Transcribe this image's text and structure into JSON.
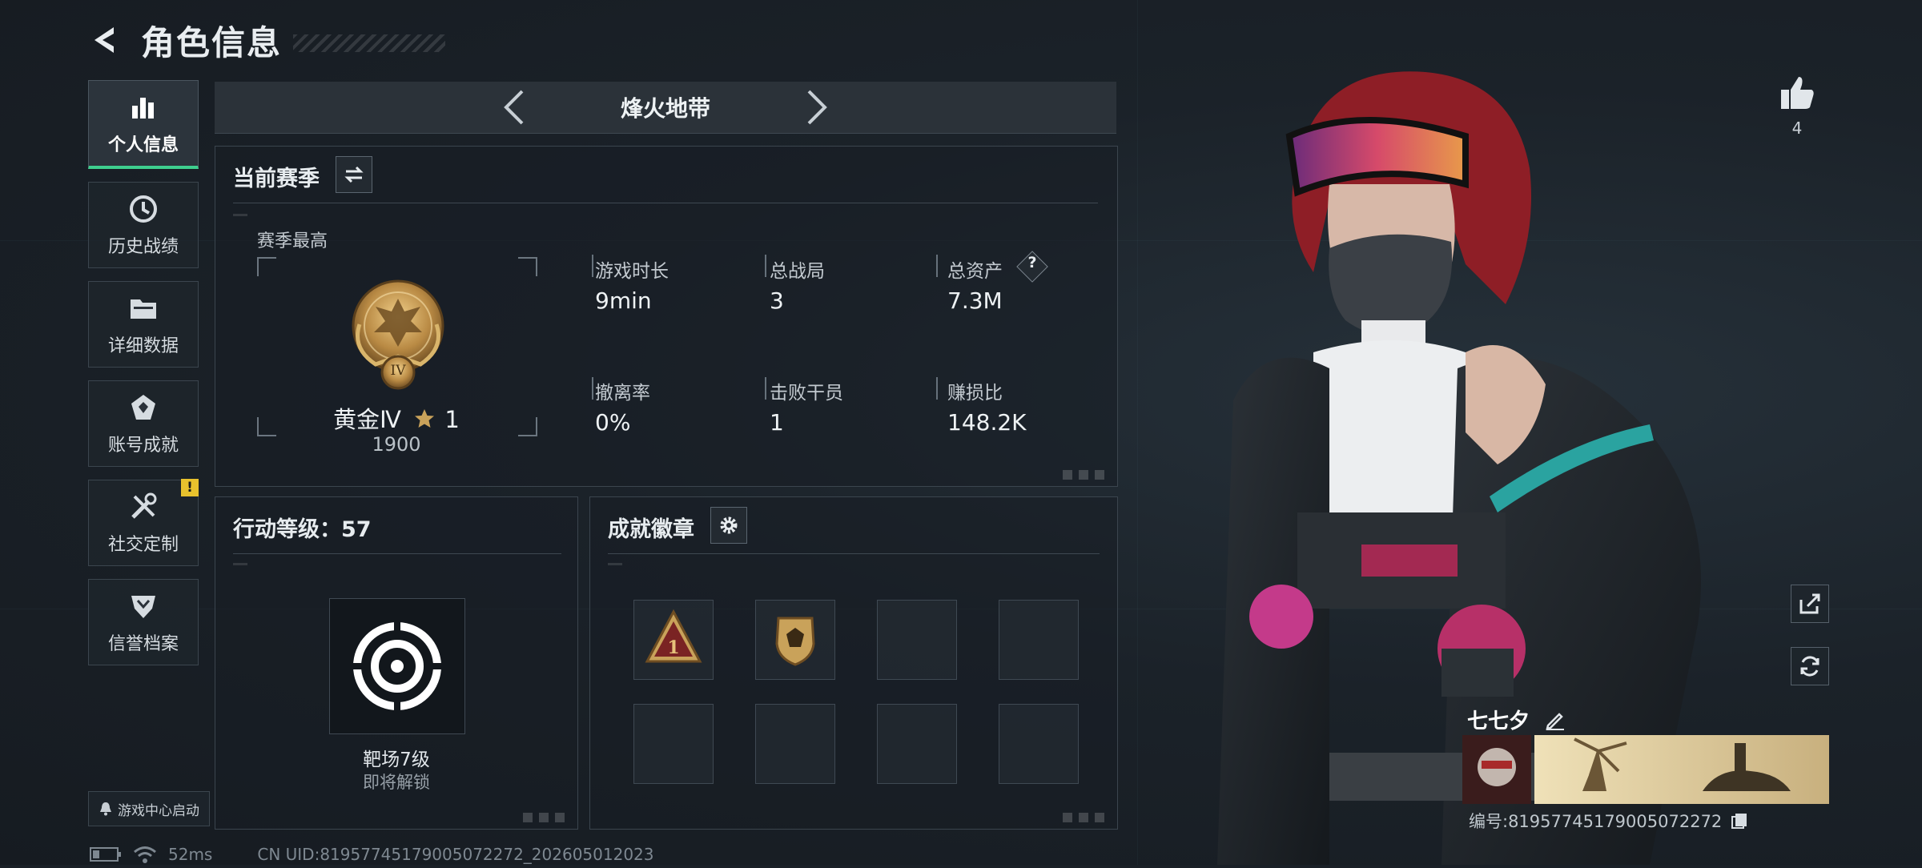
{
  "header": {
    "title": "角色信息"
  },
  "sidebar": {
    "items": [
      {
        "label": "个人信息",
        "icon": "bar-chart-icon",
        "active": true
      },
      {
        "label": "历史战绩",
        "icon": "history-clock-icon"
      },
      {
        "label": "详细数据",
        "icon": "folder-icon"
      },
      {
        "label": "账号成就",
        "icon": "achievement-icon"
      },
      {
        "label": "社交定制",
        "icon": "tools-icon",
        "alert": "!"
      },
      {
        "label": "信誉档案",
        "icon": "credit-shield-icon"
      }
    ],
    "launch_label": "游戏中心启动"
  },
  "status": {
    "ping": "52ms",
    "uid": "CN UID:81957745179005072272_202605012023"
  },
  "mode": {
    "title": "烽火地带"
  },
  "season": {
    "title": "当前赛季",
    "best_label": "赛季最高",
    "rank_name": "黄金Ⅳ",
    "rank_stars": "1",
    "rank_score": "1900",
    "rank_emblem_text": "IV",
    "stats": [
      {
        "label": "游戏时长",
        "value": "9min"
      },
      {
        "label": "总战局",
        "value": "3"
      },
      {
        "label": "总资产",
        "value": "7.3M",
        "help": "?"
      },
      {
        "label": "撤离率",
        "value": "0%"
      },
      {
        "label": "击败干员",
        "value": "1"
      },
      {
        "label": "赚损比",
        "value": "148.2K"
      }
    ]
  },
  "action_level": {
    "title": "行动等级：57",
    "target_name": "靶场7级",
    "target_status": "即将解锁"
  },
  "achievements": {
    "title": "成就徽章",
    "badge_1_text": "1"
  },
  "player": {
    "likes": "4",
    "name": "七七夕",
    "id": "编号:81957745179005072272"
  },
  "colors": {
    "accent": "#3ecf8e",
    "warning": "#e8c22d",
    "gold": "#c9a25a"
  }
}
